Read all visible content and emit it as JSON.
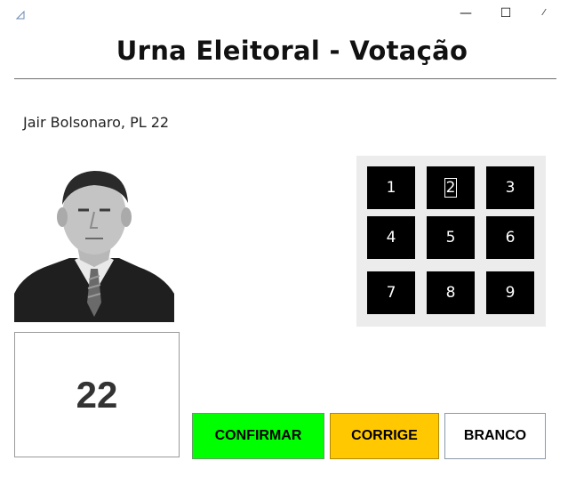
{
  "window": {
    "minimize_glyph": "—",
    "maximize_glyph": "☐",
    "close_glyph": "⁄"
  },
  "header": {
    "title": "Urna Eleitoral - Votação"
  },
  "candidate": {
    "label": "Jair Bolsonaro, PL 22"
  },
  "keypad": {
    "keys": [
      "1",
      "2",
      "3",
      "4",
      "5",
      "6",
      "7",
      "8",
      "9"
    ],
    "focused_key": "2"
  },
  "display": {
    "number": "22"
  },
  "actions": {
    "confirm_label": "CONFIRMAR",
    "corrige_label": "CORRIGE",
    "branco_label": "BRANCO"
  },
  "colors": {
    "confirm": "#00ff00",
    "corrige": "#ffc800",
    "branco": "#ffffff",
    "keypad_key": "#000000",
    "keypad_panel": "#ececec"
  }
}
